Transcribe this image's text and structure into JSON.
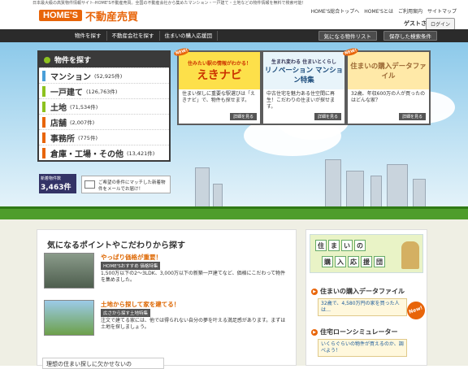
{
  "header": {
    "tagline": "日本最大級の高質物件情報サイト-HOME'S不動産売買。全国の不動産会社から集めたマンション・一戸建て・土地などの物件情報を無料で検索可能！",
    "logo_brand": "HOME'S",
    "logo_sub": "不動産売買",
    "top_links": [
      "HOME'S総合トップへ",
      "HOME'Sとは",
      "ご利用案内",
      "サイトマップ"
    ],
    "guest_label": "ゲストさん",
    "login_label": "ログイン"
  },
  "nav": {
    "left": [
      "物件を探す",
      "不動産会社を探す",
      "住まいの購入応援団"
    ],
    "right": [
      "気になる物件リスト",
      "保存した検索条件"
    ]
  },
  "search_menu": {
    "heading": "物件を探す",
    "items": [
      {
        "label": "マンション",
        "count": "(52,925件)",
        "color": "#4a9fd8"
      },
      {
        "label": "一戸建て",
        "count": "(126,763件)",
        "color": "#8dc21f"
      },
      {
        "label": "土地",
        "count": "(71,534件)",
        "color": "#8dc21f"
      },
      {
        "label": "店舗",
        "count": "(2,007件)",
        "color": "#e8650a"
      },
      {
        "label": "事務所",
        "count": "(775件)",
        "color": "#e8650a"
      },
      {
        "label": "倉庫・工場・その他",
        "count": "(13,421件)",
        "color": "#e8650a"
      }
    ],
    "new_label": "新着物件数",
    "new_count": "3,463件",
    "mail_text": "ご希望の条件にマッチした新着物件をメールでお届け！"
  },
  "cards": [
    {
      "new": "NEW!",
      "head": "住みたい駅の情報がわかる！",
      "title": "えきナビ",
      "desc": "住まい探しに重要な駅選びは「えきナビ」で、物件も探せます。",
      "more": "詳細を見る"
    },
    {
      "new": "",
      "head": "生まれ変わる 住まいとくらし",
      "title": "リノベーション マンション特集",
      "desc": "中古住宅を魅力ある住空間に再生！こだわりの住まいが探せます。",
      "more": "詳細を見る"
    },
    {
      "new": "NEW!",
      "head": "",
      "title": "住まいの購入データファイル",
      "desc": "32歳、年収600万の人が買ったのはどんな家？",
      "more": "詳細を見る"
    }
  ],
  "points": {
    "title": "気になるポイントやこだわりから探す",
    "features": [
      {
        "title": "やっぱり価格が重要！",
        "badge": "HOME'Sおすすめ 価格特集",
        "text": "1,500万以下の2〜3LDK、3,000万以下の新築一戸建てなど、価格にこだわって物件を集めました。"
      },
      {
        "title": "土地から探して家を建てる！",
        "badge": "広さから探す土地特集",
        "text": "注文で建てる家には、他では得られない自分の夢を叶える満足感があります。まずは土地を探しましょう。"
      }
    ],
    "bottom_text": "理想の住まい探しに欠かせないの"
  },
  "side": {
    "banner_chars": [
      "住",
      "ま",
      "い",
      "の",
      "購",
      "入",
      "応",
      "援",
      "団"
    ],
    "links": [
      {
        "label": "住まいの購入データファイル",
        "sub": "32歳で、4,580万円の家を買った人は…"
      },
      {
        "label": "住宅ローンシミュレーター",
        "sub": "いくらぐらいの物件が買えるのか、調べよう！"
      }
    ],
    "new_mark": "New!"
  }
}
